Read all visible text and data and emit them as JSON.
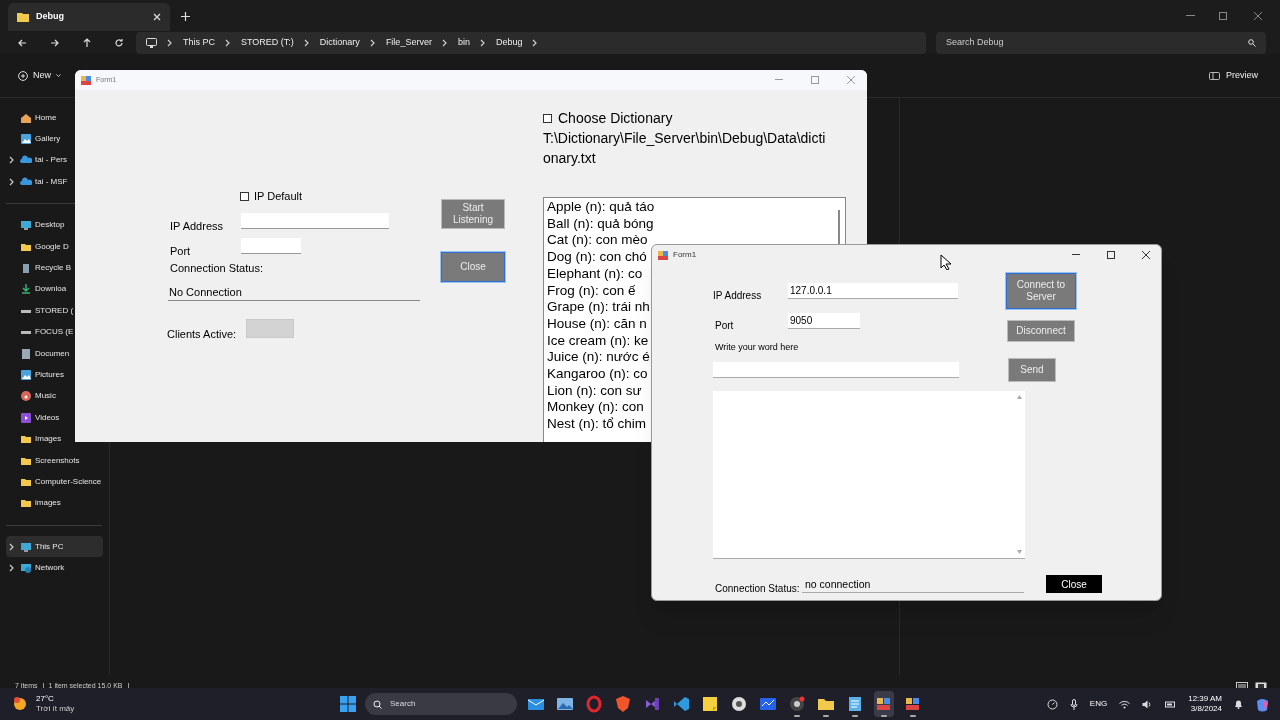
{
  "explorer": {
    "tab": {
      "title": "Debug"
    },
    "breadcrumbs": [
      "This PC",
      "STORED (T:)",
      "Dictionary",
      "File_Server",
      "bin",
      "Debug"
    ],
    "search": {
      "placeholder": "Search Debug"
    },
    "new_button": "New",
    "preview_button": "Preview",
    "sidebar": [
      [
        {
          "label": "Home",
          "kind": "home",
          "expandable": false,
          "selected": false
        },
        {
          "label": "Gallery",
          "kind": "gallery",
          "expandable": false,
          "selected": false
        },
        {
          "label": "tai - Pers",
          "kind": "cloud",
          "expandable": true,
          "selected": false
        },
        {
          "label": "tai - MSF",
          "kind": "cloud",
          "expandable": true,
          "selected": false
        }
      ],
      [
        {
          "label": "Desktop",
          "kind": "desktop",
          "expandable": false,
          "selected": false
        },
        {
          "label": "Google D",
          "kind": "folder",
          "expandable": false,
          "selected": false
        },
        {
          "label": "Recycle B",
          "kind": "recycle",
          "expandable": false,
          "selected": false
        },
        {
          "label": "Downloa",
          "kind": "download",
          "expandable": false,
          "selected": false
        },
        {
          "label": "STORED (",
          "kind": "drive",
          "expandable": false,
          "selected": false
        },
        {
          "label": "FOCUS (E",
          "kind": "drive",
          "expandable": false,
          "selected": false
        },
        {
          "label": "Documen",
          "kind": "document",
          "expandable": false,
          "selected": false
        },
        {
          "label": "Pictures",
          "kind": "gallery",
          "expandable": false,
          "selected": false
        },
        {
          "label": "Music",
          "kind": "music",
          "expandable": false,
          "selected": false
        },
        {
          "label": "Videos",
          "kind": "video",
          "expandable": false,
          "selected": false
        },
        {
          "label": "Images",
          "kind": "folder",
          "expandable": false,
          "selected": false
        },
        {
          "label": "Screenshots",
          "kind": "folder",
          "expandable": false,
          "selected": false
        },
        {
          "label": "Computer-Science",
          "kind": "folder",
          "expandable": false,
          "selected": false
        },
        {
          "label": "images",
          "kind": "folder",
          "expandable": false,
          "selected": false
        }
      ],
      [
        {
          "label": "This PC",
          "kind": "desktop",
          "expandable": true,
          "selected": true
        },
        {
          "label": "Network",
          "kind": "network",
          "expandable": true,
          "selected": false
        }
      ]
    ],
    "status_bar": [
      "7 items",
      "1 item selected 15.0 KB"
    ]
  },
  "server_form": {
    "title": "Form1",
    "choose_dictionary": {
      "label": "Choose Dictionary",
      "checked": false
    },
    "dictionary_path": "T:\\Dictionary\\File_Server\\bin\\Debug\\Data\\dictionary.txt",
    "ip_default": {
      "label": "IP Default",
      "checked": false
    },
    "ip_address_label": "IP Address",
    "port_label": "Port",
    "connection_status_label": "Connection Status:",
    "connection_status": "No Connection",
    "clients_active_label": "Clients Active:",
    "buttons": [
      {
        "label": "Start Listening",
        "focused": false
      },
      {
        "label": "Close",
        "focused": true
      }
    ],
    "dictionary_list": [
      "Apple (n): quả táo",
      "Ball (n): quả bóng",
      "Cat (n): con mèo",
      "Dog (n): con chó",
      "Elephant (n): co",
      "Frog (n): con ế",
      "Grape (n): trái nh",
      "House (n): căn n",
      "Ice cream (n): ke",
      "Juice (n): nước é",
      "Kangaroo (n): co",
      "Lion (n): con sư",
      "Monkey (n): con",
      "Nest (n): tổ chim"
    ]
  },
  "client_form": {
    "title": "Form1",
    "ip_address": {
      "label": "IP Address",
      "value": "127.0.0.1"
    },
    "port": {
      "label": "Port",
      "value": "9050"
    },
    "word_label": "Write your word here",
    "buttons": [
      {
        "label": "Connect to Server",
        "focused": true
      },
      {
        "label": "Disconnect",
        "focused": false
      },
      {
        "label": "Send",
        "focused": false
      }
    ],
    "status_label": "Connection Status:",
    "status_value": "no connection",
    "close_button": "Close"
  },
  "taskbar": {
    "weather": {
      "temperature": "27°C",
      "condition": "Trời ít mây"
    },
    "search": {
      "placeholder": "Search"
    },
    "apps": [
      {
        "kind": "mail",
        "running": false,
        "selected": false
      },
      {
        "kind": "photos",
        "running": false,
        "selected": false
      },
      {
        "kind": "ring",
        "running": false,
        "selected": false
      },
      {
        "kind": "shield",
        "running": false,
        "selected": false
      },
      {
        "kind": "vstudio",
        "running": false,
        "selected": false
      },
      {
        "kind": "vscode",
        "running": false,
        "selected": false
      },
      {
        "kind": "note",
        "running": false,
        "selected": false
      },
      {
        "kind": "disc",
        "running": false,
        "selected": false
      },
      {
        "kind": "board",
        "running": false,
        "selected": false
      },
      {
        "kind": "browser",
        "running": true,
        "selected": false
      },
      {
        "kind": "folder",
        "running": true,
        "selected": false
      },
      {
        "kind": "notepad",
        "running": true,
        "selected": false
      },
      {
        "kind": "winform",
        "running": true,
        "selected": true
      },
      {
        "kind": "winform",
        "running": true,
        "selected": false
      }
    ],
    "language": "ENG",
    "time": "12:39 AM",
    "date": "3/8/2024"
  }
}
